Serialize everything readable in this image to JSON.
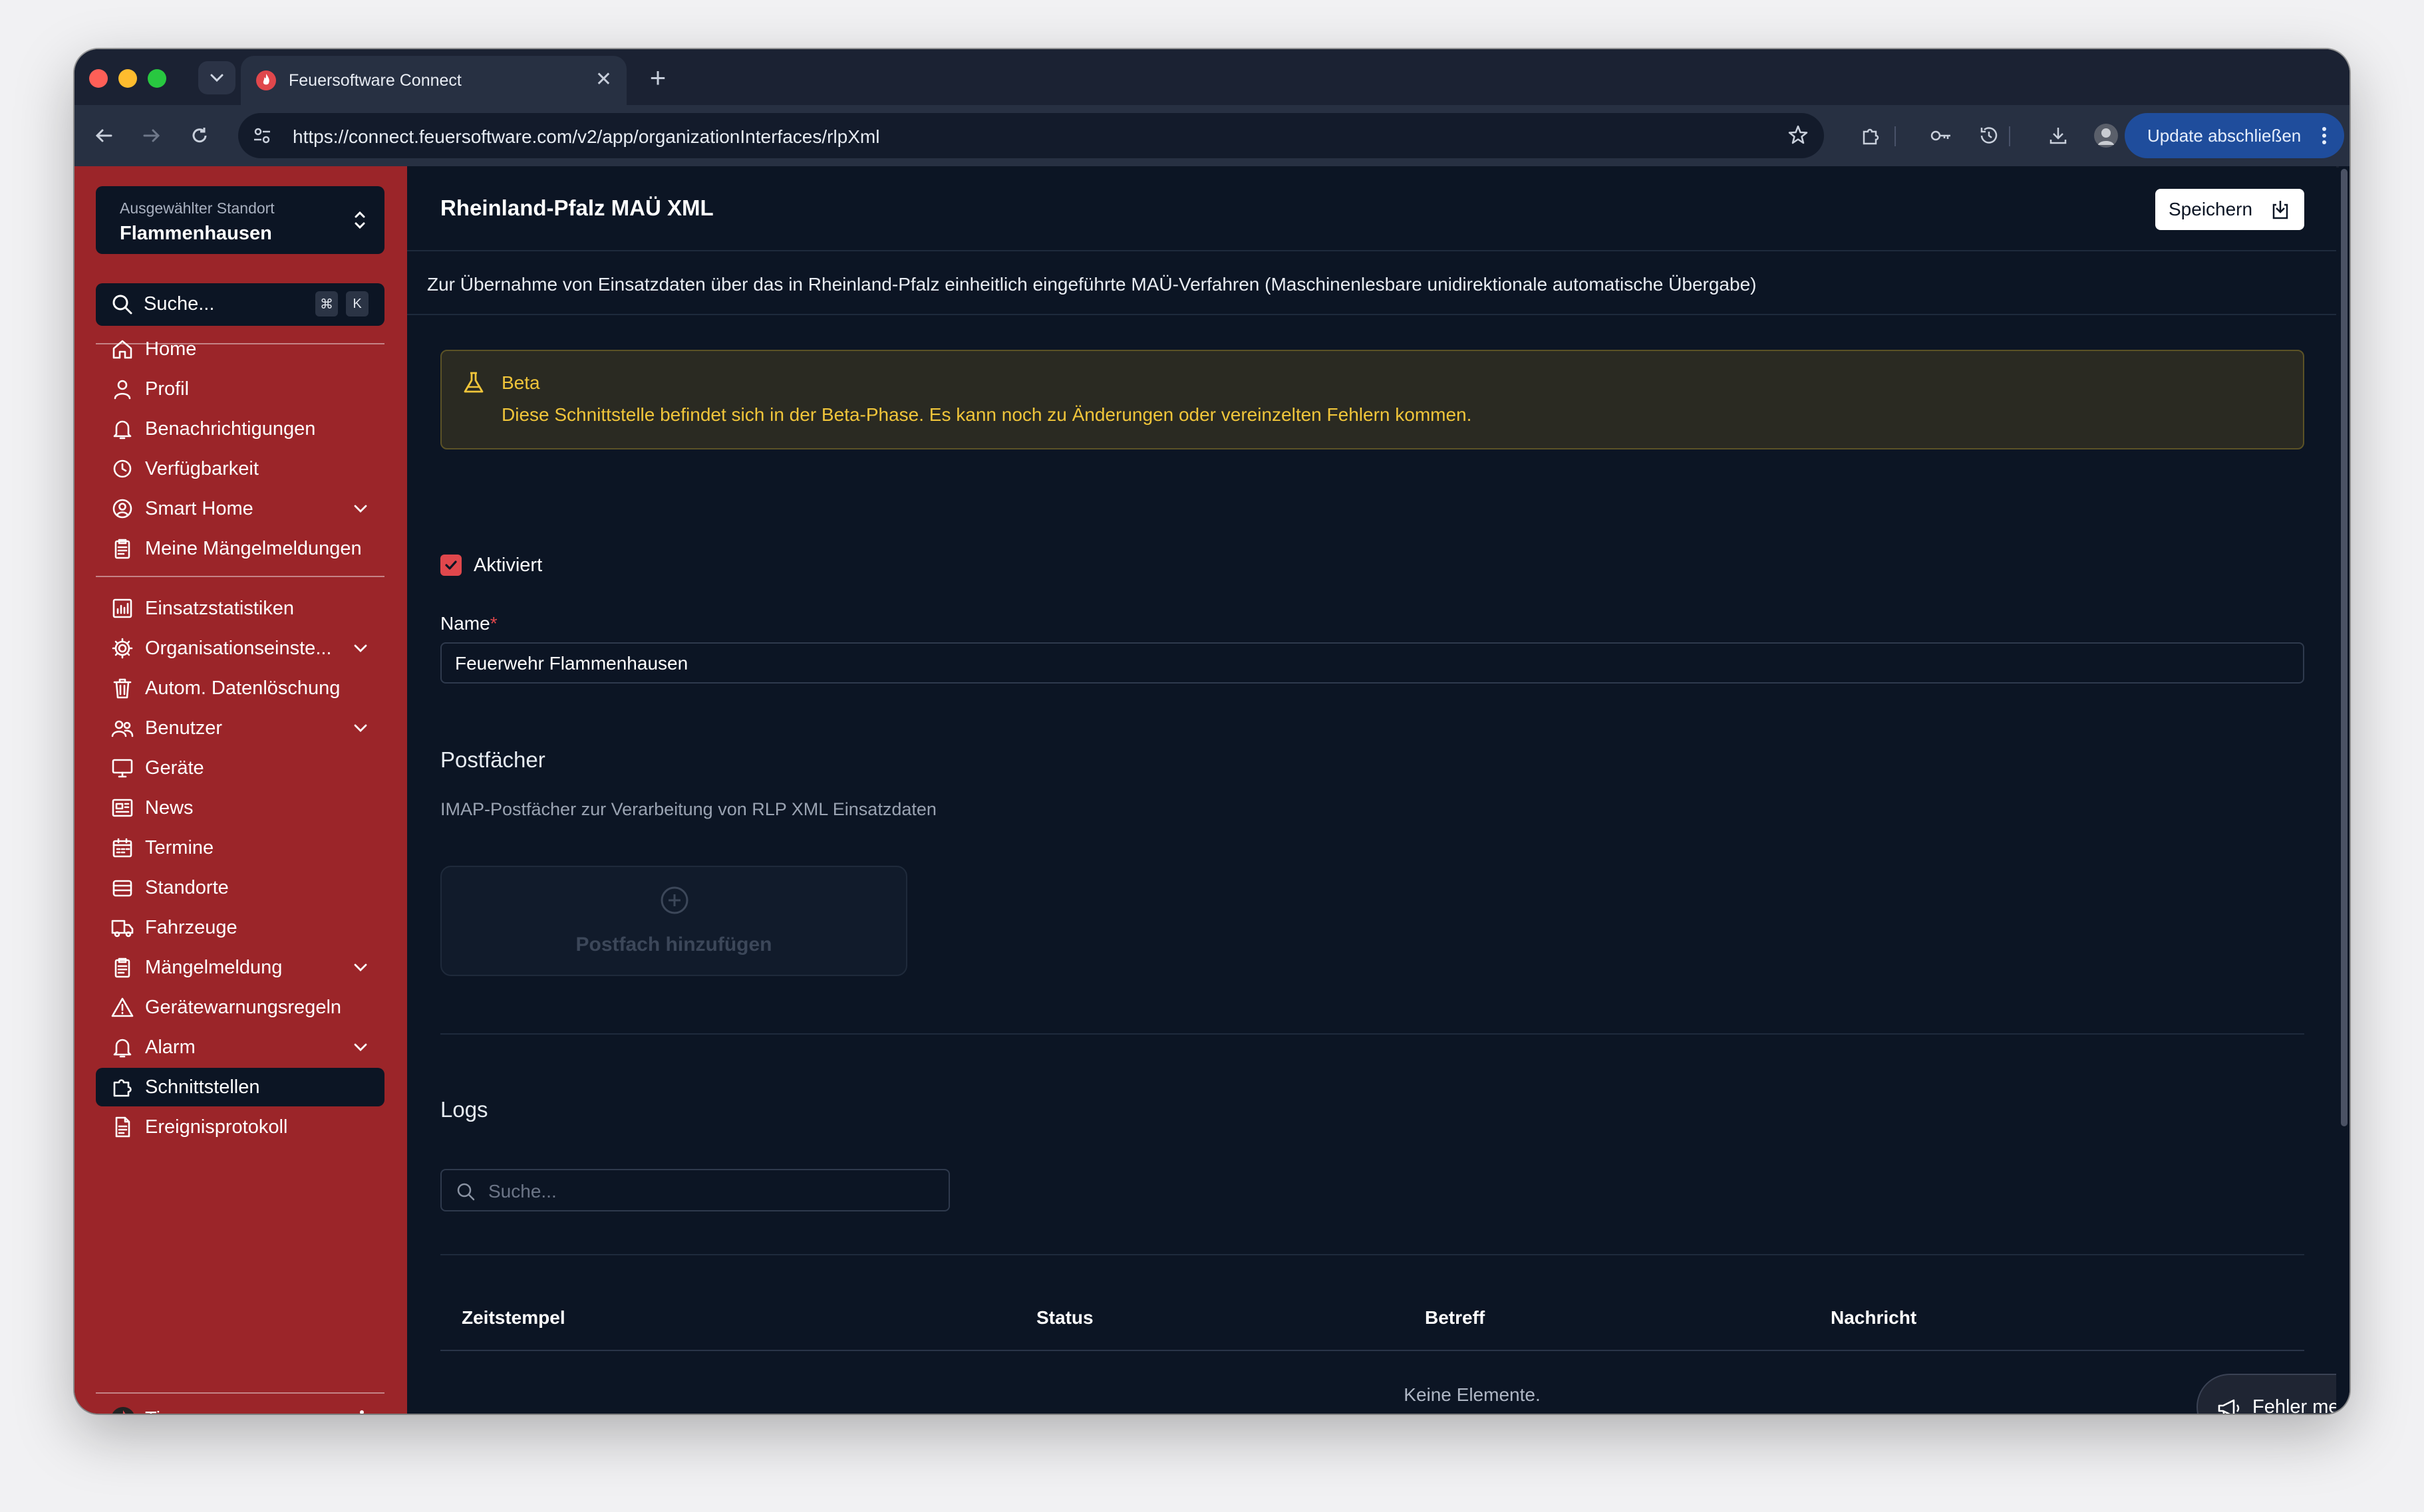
{
  "browser": {
    "tab_title": "Feuersoftware Connect",
    "url": "https://connect.feuersoftware.com/v2/app/organizationInterfaces/rlpXml",
    "update_label": "Update abschließen"
  },
  "sidebar": {
    "location_label": "Ausgewählter Standort",
    "location_value": "Flammenhausen",
    "search_label": "Suche...",
    "shortcut_keys": [
      "⌘",
      "K"
    ],
    "items": [
      {
        "label": "Home",
        "icon": "home-icon"
      },
      {
        "label": "Profil",
        "icon": "user-icon"
      },
      {
        "label": "Benachrichtigungen",
        "icon": "bell-icon"
      },
      {
        "label": "Verfügbarkeit",
        "icon": "clock-icon"
      },
      {
        "label": "Smart Home",
        "icon": "user-circle-icon",
        "expandable": true
      },
      {
        "label": "Meine Mängelmeldungen",
        "icon": "clipboard-icon"
      },
      {
        "label": "Einsatzstatistiken",
        "icon": "chart-icon"
      },
      {
        "label": "Organisationseinste...",
        "icon": "gear-icon",
        "expandable": true
      },
      {
        "label": "Autom. Datenlöschung",
        "icon": "trash-icon"
      },
      {
        "label": "Benutzer",
        "icon": "users-icon",
        "expandable": true
      },
      {
        "label": "Geräte",
        "icon": "monitor-icon"
      },
      {
        "label": "News",
        "icon": "newspaper-icon"
      },
      {
        "label": "Termine",
        "icon": "calendar-icon"
      },
      {
        "label": "Standorte",
        "icon": "building-icon"
      },
      {
        "label": "Fahrzeuge",
        "icon": "truck-icon"
      },
      {
        "label": "Mängelmeldung",
        "icon": "clipboard-icon",
        "expandable": true
      },
      {
        "label": "Gerätewarnungsregeln",
        "icon": "warning-icon"
      },
      {
        "label": "Alarm",
        "icon": "bell-icon",
        "expandable": true
      },
      {
        "label": "Schnittstellen",
        "icon": "puzzle-icon",
        "active": true
      },
      {
        "label": "Ereignisprotokoll",
        "icon": "document-icon"
      }
    ],
    "user_name": "Timo"
  },
  "main": {
    "title": "Rheinland-Pfalz MAÜ XML",
    "save_label": "Speichern",
    "description": "Zur Übernahme von Einsatzdaten über das in Rheinland-Pfalz einheitlich eingeführte MAÜ-Verfahren (Maschinenlesbare unidirektionale automatische Übergabe)",
    "beta": {
      "title": "Beta",
      "message": "Diese Schnittstelle befindet sich in der Beta-Phase. Es kann noch zu Änderungen oder vereinzelten Fehlern kommen."
    },
    "enabled_label": "Aktiviert",
    "enabled": true,
    "name_label": "Name",
    "name_required_mark": "*",
    "name_value": "Feuerwehr Flammenhausen",
    "mailboxes": {
      "title": "Postfächer",
      "description": "IMAP-Postfächer zur Verarbeitung von RLP XML Einsatzdaten",
      "add_label": "Postfach hinzufügen"
    },
    "logs": {
      "title": "Logs",
      "search_placeholder": "Suche...",
      "columns": [
        "Zeitstempel",
        "Status",
        "Betreff",
        "Nachricht"
      ],
      "empty_text": "Keine Elemente."
    },
    "report_label": "Fehler melden"
  },
  "colors": {
    "sidebar": "#9b2529",
    "background": "#0c1524",
    "accent": "#e0474c",
    "warning": "#f0c53a",
    "update_button": "#1f4d9c"
  }
}
